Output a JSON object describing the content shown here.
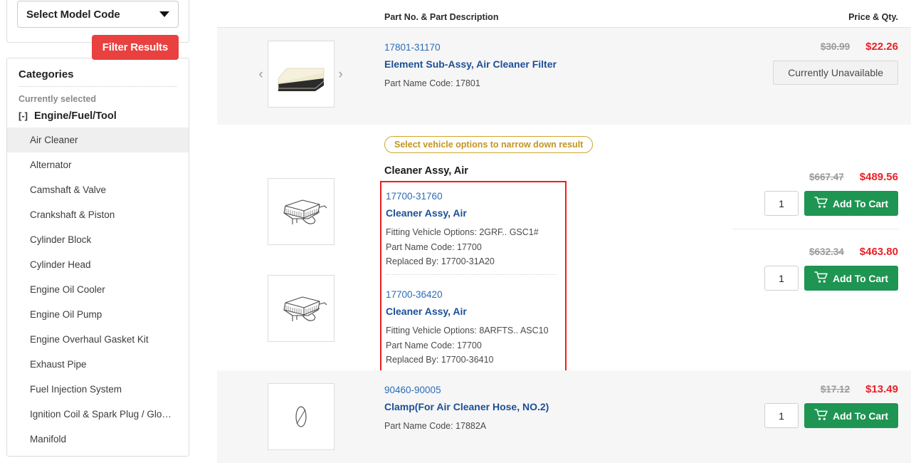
{
  "sidebar": {
    "model_select": {
      "label": "Select Model Code",
      "caret_icon": "chevron-down-icon"
    },
    "filter_button": "Filter Results",
    "categories": {
      "title": "Categories",
      "currently_selected_label": "Currently selected",
      "selected_toggle": "[-]",
      "selected_name": "Engine/Fuel/Tool",
      "items": [
        "Air Cleaner",
        "Alternator",
        "Camshaft & Valve",
        "Crankshaft & Piston",
        "Cylinder Block",
        "Cylinder Head",
        "Engine Oil Cooler",
        "Engine Oil Pump",
        "Engine Overhaul Gasket Kit",
        "Exhaust Pipe",
        "Fuel Injection System",
        "Ignition Coil & Spark Plug / Glow P…",
        "Manifold"
      ],
      "active_index": 0
    }
  },
  "colors": {
    "accent_red": "#e8413f",
    "price_red": "#ea2127",
    "link_blue": "#1c4f96",
    "cart_green": "#1e9552",
    "highlight_box": "#f21d1d",
    "note_gold": "#c2951f"
  },
  "list_header": {
    "part_column": "Part No. & Part Description",
    "price_column": "Price & Qty."
  },
  "rows": [
    {
      "part_no": "17801-31170",
      "description": "Element Sub-Assy, Air Cleaner Filter",
      "part_name_code": "Part Name Code: 17801",
      "price_old": "$30.99",
      "price_new": "$22.26",
      "unavailable_label": "Currently Unavailable",
      "prev_icon": "chevron-left-icon",
      "next_icon": "chevron-right-icon"
    }
  ],
  "group": {
    "note": "Select vehicle options to narrow down result",
    "title": "Cleaner Assy, Air",
    "items": [
      {
        "part_no": "17700-31760",
        "description": "Cleaner Assy, Air",
        "fitting": "Fitting Vehicle Options: 2GRF.. GSC1#",
        "part_name_code": "Part Name Code: 17700",
        "replaced_by": "Replaced By: 17700-31A20",
        "price_old": "$667.47",
        "price_new": "$489.56",
        "qty": "1",
        "cart_label": "Add To Cart"
      },
      {
        "part_no": "17700-36420",
        "description": "Cleaner Assy, Air",
        "fitting": "Fitting Vehicle Options: 8ARFTS.. ASC10",
        "part_name_code": "Part Name Code: 17700",
        "replaced_by": "Replaced By: 17700-36410",
        "price_old": "$632.34",
        "price_new": "$463.80",
        "qty": "1",
        "cart_label": "Add To Cart"
      }
    ]
  },
  "last_row": {
    "part_no": "90460-90005",
    "description": "Clamp(For Air Cleaner Hose, NO.2)",
    "part_name_code": "Part Name Code: 17882A",
    "price_old": "$17.12",
    "price_new": "$13.49",
    "qty": "1",
    "cart_label": "Add To Cart"
  }
}
